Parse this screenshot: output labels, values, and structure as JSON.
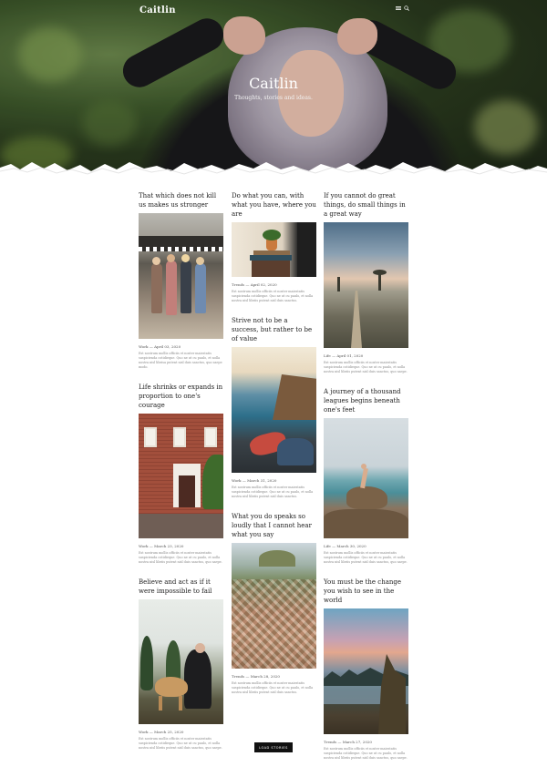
{
  "header": {
    "site_title": "Caitlin",
    "hero_heading": "Caitlin",
    "hero_tagline": "Thoughts, stories and ideas.",
    "menu_icon": "hamburger-icon",
    "search_icon": "search-icon"
  },
  "columns": [
    [
      {
        "title": "That which does not kill us makes us stronger",
        "category": "Work",
        "date": "April 03, 2020",
        "image": "storefront-women-photo",
        "excerpt": "Est nostrum mollis officiis et noster maiestatis suspicienda cotidieque. Quo ne ut cu paulo, et nolla nostra nisl librisa putent nisl duis sanctus, quo saepe modo."
      },
      {
        "title": "Life shrinks or expands in proportion to one's courage",
        "category": "Work",
        "date": "March 23, 2020",
        "image": "brick-house-photo",
        "excerpt": "Est nostrum mollis officiis et noster maiestatis suspicienda cotidieque. Quo ne ut cu paulo, et nolla nostra nisl libriis putent nisl duis sanctus, quo saepe."
      },
      {
        "title": "Believe and act as if it were impossible to fail",
        "category": "Work",
        "date": "March 25, 2020",
        "image": "dog-man-photo",
        "excerpt": "Est nostrum mollis officiis et noster maiestatis suspicienda cotidieque. Quo ne ut cu paulo, et nolla nostra nisl libriis putent nisl duis sanctus, quo saepe."
      }
    ],
    [
      {
        "title": "Do what you can, with what you have, where you are",
        "category": "Trends",
        "date": "April 02, 2020",
        "image": "plant-books-photo",
        "excerpt": "Est nostrum mollis officiis et noster maiestatis suspicienda cotidieque. Quo ne ut cu paulo, et nolla nostra nisl libriis putent nisl duis sanctus."
      },
      {
        "title": "Strive not to be a success, but rather to be of value",
        "category": "Work",
        "date": "March 31, 2020",
        "image": "coast-feet-photo",
        "excerpt": "Est nostrum mollis officiis et noster maiestatis suspicienda cotidieque. Quo ne ut cu paulo, et nolla nostra nisl libriis putent nisl duis sanctus."
      },
      {
        "title": "What you do speaks so loudly that I cannot hear what you say",
        "category": "Trends",
        "date": "March 28, 2020",
        "image": "city-aerial-photo",
        "excerpt": "Est nostrum mollis officiis et noster maiestatis suspicienda cotidieque. Quo ne ut cu paulo, et nolla nostra nisl libriis putent nisl duis sanctus."
      }
    ],
    [
      {
        "title": "If you cannot do great things, do small things in a great way",
        "category": "Life",
        "date": "April 01, 2020",
        "image": "desert-path-photo",
        "excerpt": "Est nostrum mollis officiis et noster maiestatis suspicienda cotidieque. Quo ne ut cu paulo, et nolla nostra nisl libriis putent nisl duis sanctus, quo saepe."
      },
      {
        "title": "A journey of a thousand leagues begins beneath one's feet",
        "category": "Life",
        "date": "March 30, 2020",
        "image": "rocks-sea-photo",
        "excerpt": "Est nostrum mollis officiis et noster maiestatis suspicienda cotidieque. Quo ne ut cu paulo, et nolla nostra nisl libriis putent nisl duis sanctus, quo saepe."
      },
      {
        "title": "You must be the change you wish to see in the world",
        "category": "Trends",
        "date": "March 27, 2020",
        "image": "lake-sunset-photo",
        "excerpt": "Est nostrum mollis officiis et noster maiestatis suspicienda cotidieque. Quo ne ut cu paulo, et nolla nostra nisl libriis putent nisl duis sanctus, quo saepe."
      }
    ]
  ],
  "load_more_label": "LOAD STORIES"
}
